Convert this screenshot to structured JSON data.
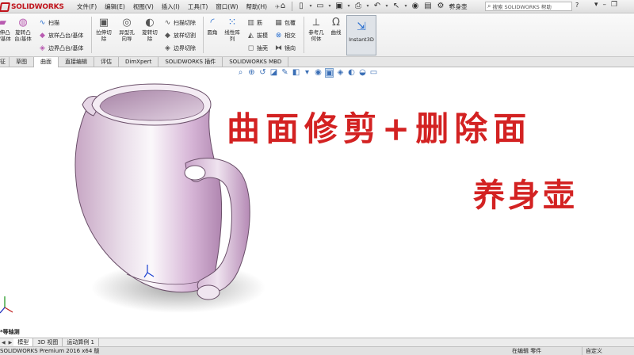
{
  "app": {
    "logo_text": "SOLIDWORKS",
    "doc_name": "养身壶"
  },
  "menu": {
    "items": [
      "文件(F)",
      "编辑(E)",
      "视图(V)",
      "插入(I)",
      "工具(T)",
      "窗口(W)",
      "帮助(H)"
    ]
  },
  "search": {
    "placeholder": "搜索 SOLIDWORKS 帮助"
  },
  "help": {
    "question": "?"
  },
  "commands": {
    "extrude_boss": "拉伸凸\n台/基体",
    "revolve_boss": "旋转凸\n台/基体",
    "sweep": "扫描",
    "loft_boss": "放样凸台/基体",
    "boundary_boss": "边界凸台/基体",
    "extrude_cut": "拉伸切\n除",
    "hole_wizard": "异型孔\n向导",
    "revolve_cut": "旋转切\n除",
    "swept_cut": "扫描切除",
    "lofted_cut": "放样切割",
    "boundary_cut": "边界切除",
    "fillet": "圆角",
    "linear_pattern": "线性阵\n列",
    "rib": "筋",
    "draft": "拔模",
    "shell": "抽壳",
    "wrap": "包覆",
    "intersect": "相交",
    "mirror": "镜向",
    "reference_geometry": "参考几\n何体",
    "curves": "曲线",
    "instant3d": "Instant3D"
  },
  "tabs": [
    "征",
    "草图",
    "曲面",
    "直接编辑",
    "评估",
    "DimXpert",
    "SOLIDWORKS 插件",
    "SOLIDWORKS MBD"
  ],
  "overlay": {
    "title": "曲面修剪+删除面",
    "subtitle": "养身壶"
  },
  "view": {
    "label": "*等轴测"
  },
  "bottom_tabs": [
    "模型",
    "3D 视图",
    "运动算例 1"
  ],
  "status": {
    "version": "SOLIDWORKS Premium 2016 x64 版",
    "mode": "在编辑 零件",
    "units": "自定义"
  }
}
